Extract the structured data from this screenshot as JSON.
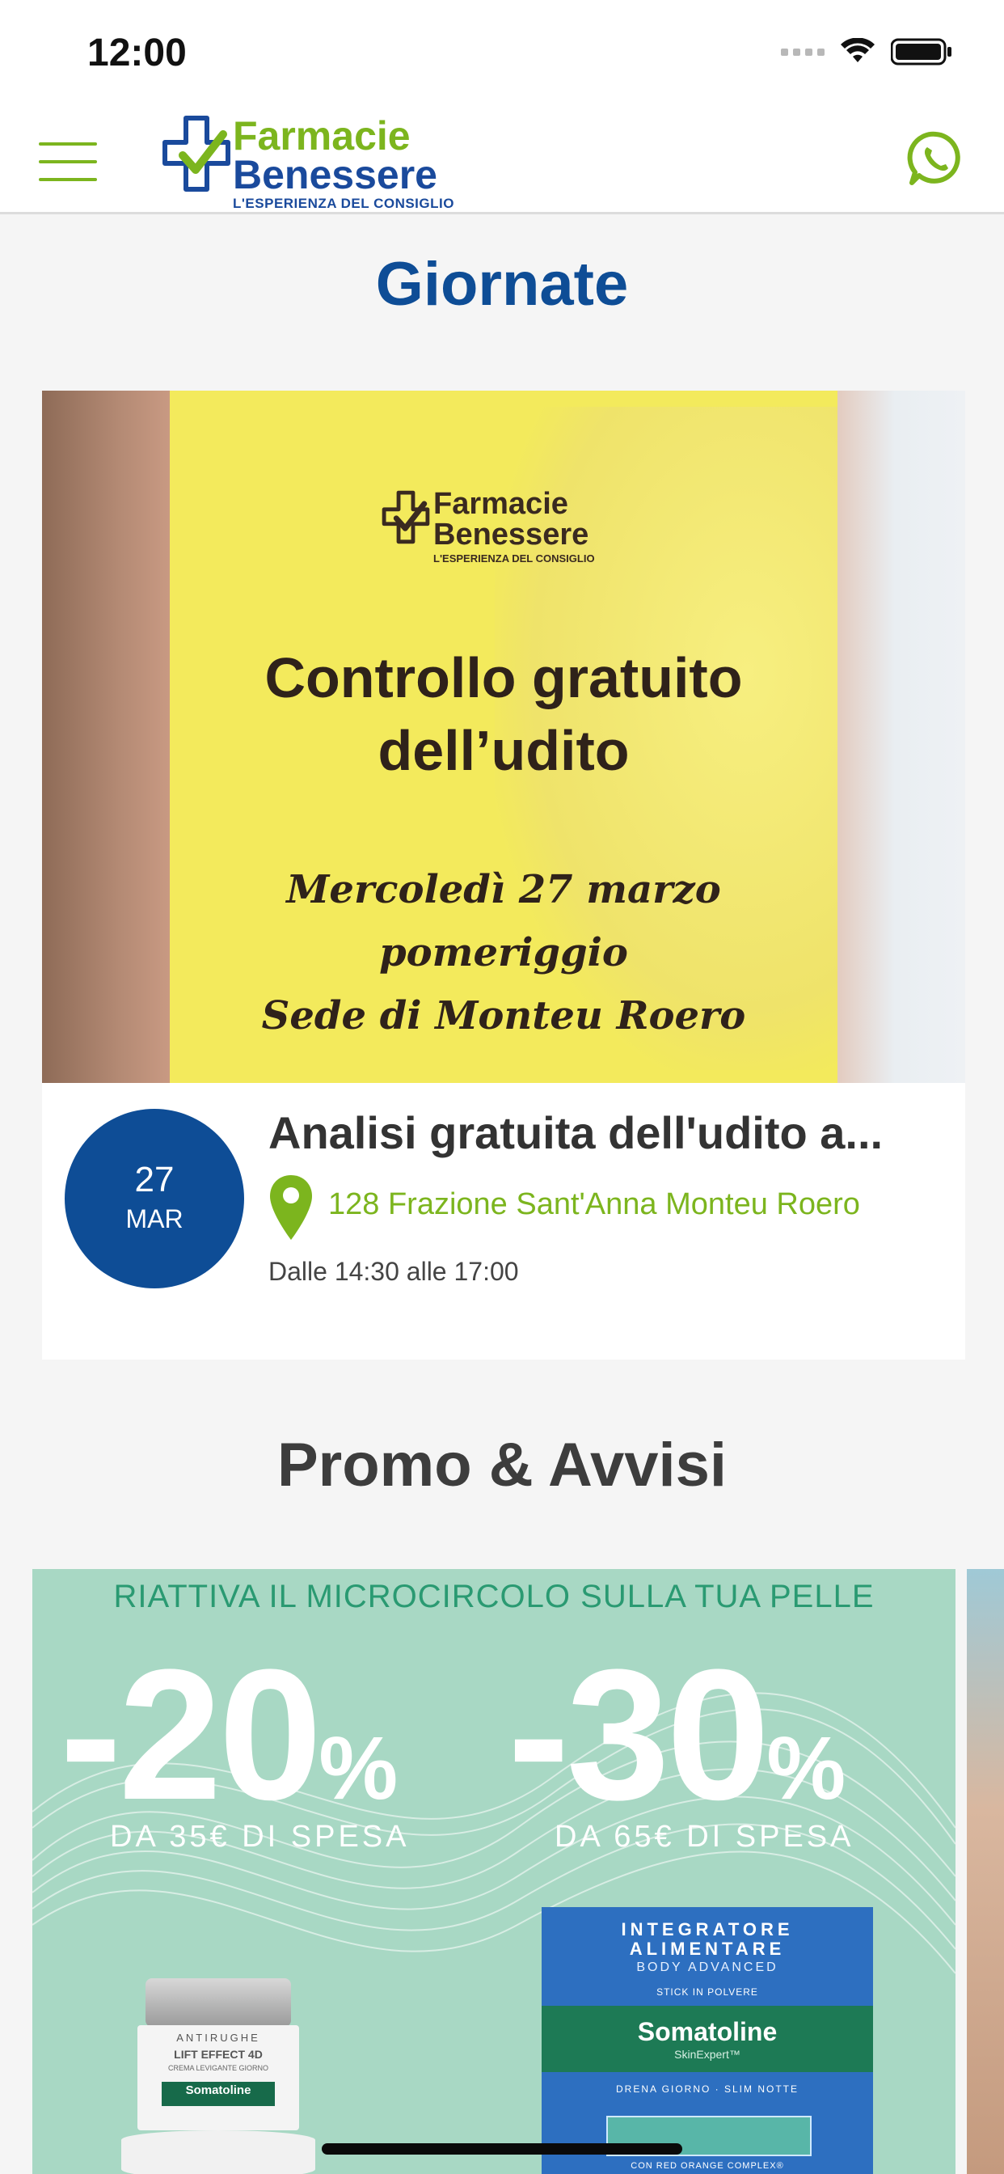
{
  "status_bar": {
    "time": "12:00"
  },
  "header": {
    "logo": {
      "line1": "Farmacie",
      "line2": "Benessere",
      "tagline": "L'ESPERIENZA DEL CONSIGLIO"
    },
    "menu_icon": "hamburger-icon",
    "whatsapp_icon": "whatsapp-icon",
    "accent_color": "#7cb51e",
    "brand_color": "#1a4a9c"
  },
  "sections": {
    "events_title": "Giornate",
    "promo_title": "Promo & Avvisi"
  },
  "event": {
    "image": {
      "logo_line1": "Farmacie",
      "logo_line2": "Benessere",
      "logo_tagline": "L'ESPERIENZA DEL CONSIGLIO",
      "headline_line1": "Controllo gratuito",
      "headline_line2": "dell’udito",
      "sub_line1": "Mercoledì 27 marzo pomeriggio",
      "sub_line2": "Sede di Monteu Roero"
    },
    "date_day": "27",
    "date_month": "MAR",
    "title": "Analisi gratuita dell'udito a...",
    "address": "128 Frazione Sant'Anna Monteu Roero",
    "time": "Dalle 14:30 alle 17:00",
    "date_color": "#0e4d96"
  },
  "promo": {
    "banner": "RIATTIVA IL MICROCIRCOLO SULLA TUA PELLE",
    "offer1_value": "-20",
    "offer1_pct": "%",
    "offer1_condition": "DA 35€ DI SPESA",
    "offer2_value": "-30",
    "offer2_pct": "%",
    "offer2_condition": "DA 65€ DI SPESA",
    "jar": {
      "line1": "ANTIRUGHE",
      "line2": "LIFT EFFECT 4D",
      "line3": "CREMA LEVIGANTE GIORNO",
      "brand": "Somatoline"
    },
    "box": {
      "line1": "INTEGRATORE",
      "line2": "ALIMENTARE",
      "line3": "BODY ADVANCED",
      "line4": "STICK IN POLVERE",
      "brand": "Somatoline",
      "brand_sub": "SkinExpert™",
      "line5": "DRENA GIORNO · SLIM NOTTE",
      "line6": "CON RED ORANGE COMPLEX®"
    }
  }
}
